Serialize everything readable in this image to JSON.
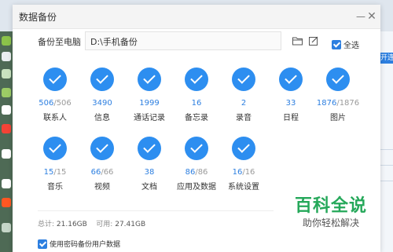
{
  "window": {
    "title": "数据备份",
    "minimize_icon": "minus-icon",
    "close_icon": "close-icon"
  },
  "destination": {
    "label": "备份至电脑",
    "path": "D:\\手机备份",
    "folder_icon": "folder-icon",
    "edit_icon": "edit-icon",
    "select_all_label": "全选",
    "select_all_checked": true
  },
  "categories": [
    {
      "id": "contacts",
      "name": "联系人",
      "done": "506",
      "total": "506"
    },
    {
      "id": "messages",
      "name": "信息",
      "done": "3490",
      "total": ""
    },
    {
      "id": "call-log",
      "name": "通话记录",
      "done": "1999",
      "total": ""
    },
    {
      "id": "memo",
      "name": "备忘录",
      "done": "16",
      "total": ""
    },
    {
      "id": "recordings",
      "name": "录音",
      "done": "2",
      "total": ""
    },
    {
      "id": "calendar",
      "name": "日程",
      "done": "33",
      "total": ""
    },
    {
      "id": "photos",
      "name": "图片",
      "done": "1876",
      "total": "1876"
    },
    {
      "id": "music",
      "name": "音乐",
      "done": "15",
      "total": "15"
    },
    {
      "id": "videos",
      "name": "视频",
      "done": "66",
      "total": "66"
    },
    {
      "id": "documents",
      "name": "文档",
      "done": "38",
      "total": ""
    },
    {
      "id": "apps",
      "name": "应用及数据",
      "done": "86",
      "total": "86"
    },
    {
      "id": "settings",
      "name": "系统设置",
      "done": "16",
      "total": "16"
    }
  ],
  "storage": {
    "total_label": "总计:",
    "total": "21.16GB",
    "available_label": "可用:",
    "available": "27.41GB"
  },
  "encrypt": {
    "label": "使用密码备份用户数据",
    "checked": true
  },
  "watermark": {
    "title": "百科全说",
    "subtitle": "助你轻松解决"
  },
  "background": {
    "right_button_text": "开连接"
  },
  "colors": {
    "accent": "#2d8ef0",
    "accent_dark": "#2d7fe0",
    "watermark_green": "#25a85a"
  }
}
